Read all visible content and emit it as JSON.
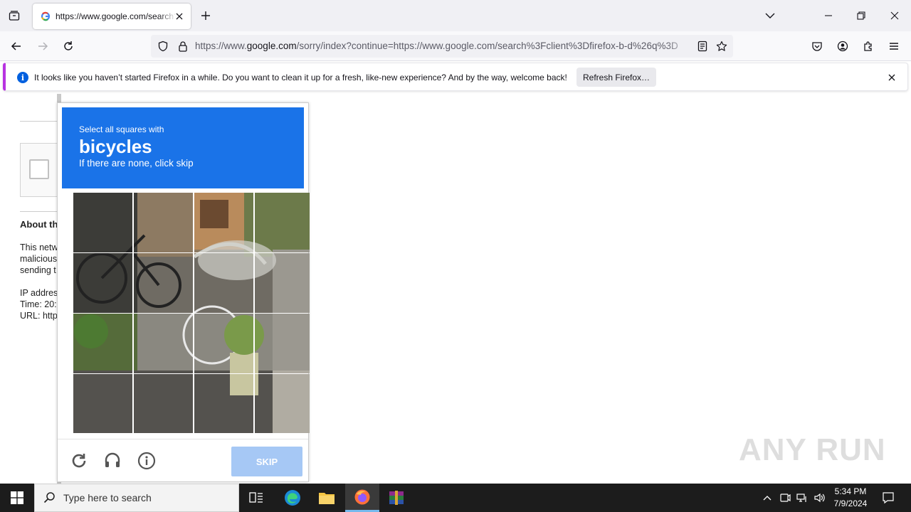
{
  "browser": {
    "tab_title": "https://www.google.com/search?client=firefox-b-d",
    "url_prefix": "https://www.",
    "url_domain": "google.com",
    "url_rest": "/sorry/index?continue=https://www.google.com/search%3Fclient%3Dfirefox-b-d%26q%3D"
  },
  "notification": {
    "message": "It looks like you haven’t started Firefox in a while. Do you want to clean it up for a fresh, like-new experience? And by the way, welcome back!",
    "button_label": "Refresh Firefox…"
  },
  "page": {
    "about_heading": "About th",
    "para1": [
      "This netw",
      "malicious",
      "sending t"
    ],
    "para2": [
      "IP addres",
      "Time: 20:",
      "URL: http"
    ]
  },
  "captcha": {
    "instruction_line1": "Select all squares with",
    "target": "bicycles",
    "instruction_line3": "If there are none, click skip",
    "skip_label": "SKIP"
  },
  "watermark": "ANY RUN",
  "taskbar": {
    "search_placeholder": "Type here to search",
    "time": "5:34 PM",
    "date": "7/9/2024"
  },
  "colors": {
    "captcha_header": "#1a73e8",
    "skip_disabled": "#a6c8f5",
    "notification_accent": "#b833e1"
  }
}
